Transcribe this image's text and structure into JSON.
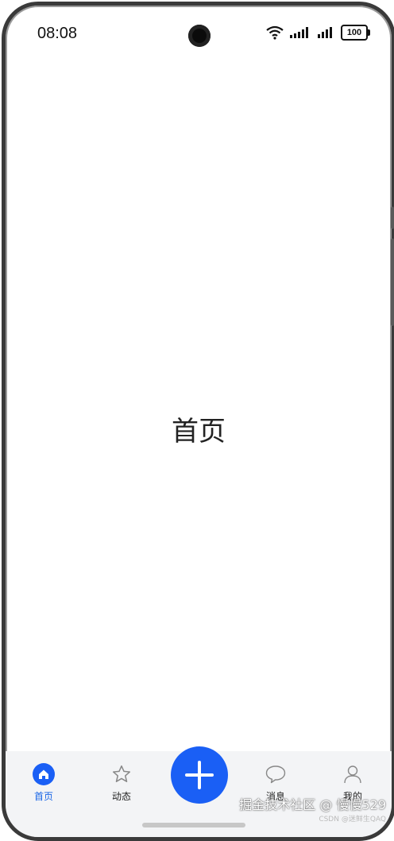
{
  "status_bar": {
    "time": "08:08",
    "battery": "100",
    "icons": [
      "wifi-icon",
      "signal-icon",
      "signal-icon"
    ]
  },
  "main": {
    "title": "首页"
  },
  "tabbar": {
    "accent_color": "#1a5ff5",
    "items": [
      {
        "label": "首页",
        "icon": "home-icon",
        "active": true
      },
      {
        "label": "动态",
        "icon": "star-icon",
        "active": false
      },
      {
        "label": "",
        "icon": "plus-icon",
        "active": false
      },
      {
        "label": "消息",
        "icon": "chat-bubble-icon",
        "active": false
      },
      {
        "label": "我的",
        "icon": "user-icon",
        "active": false
      }
    ]
  },
  "watermark": {
    "main": "掘金技术社区 @ 慢慢529",
    "sub": "CSDN @迷鲜生QAQ"
  }
}
